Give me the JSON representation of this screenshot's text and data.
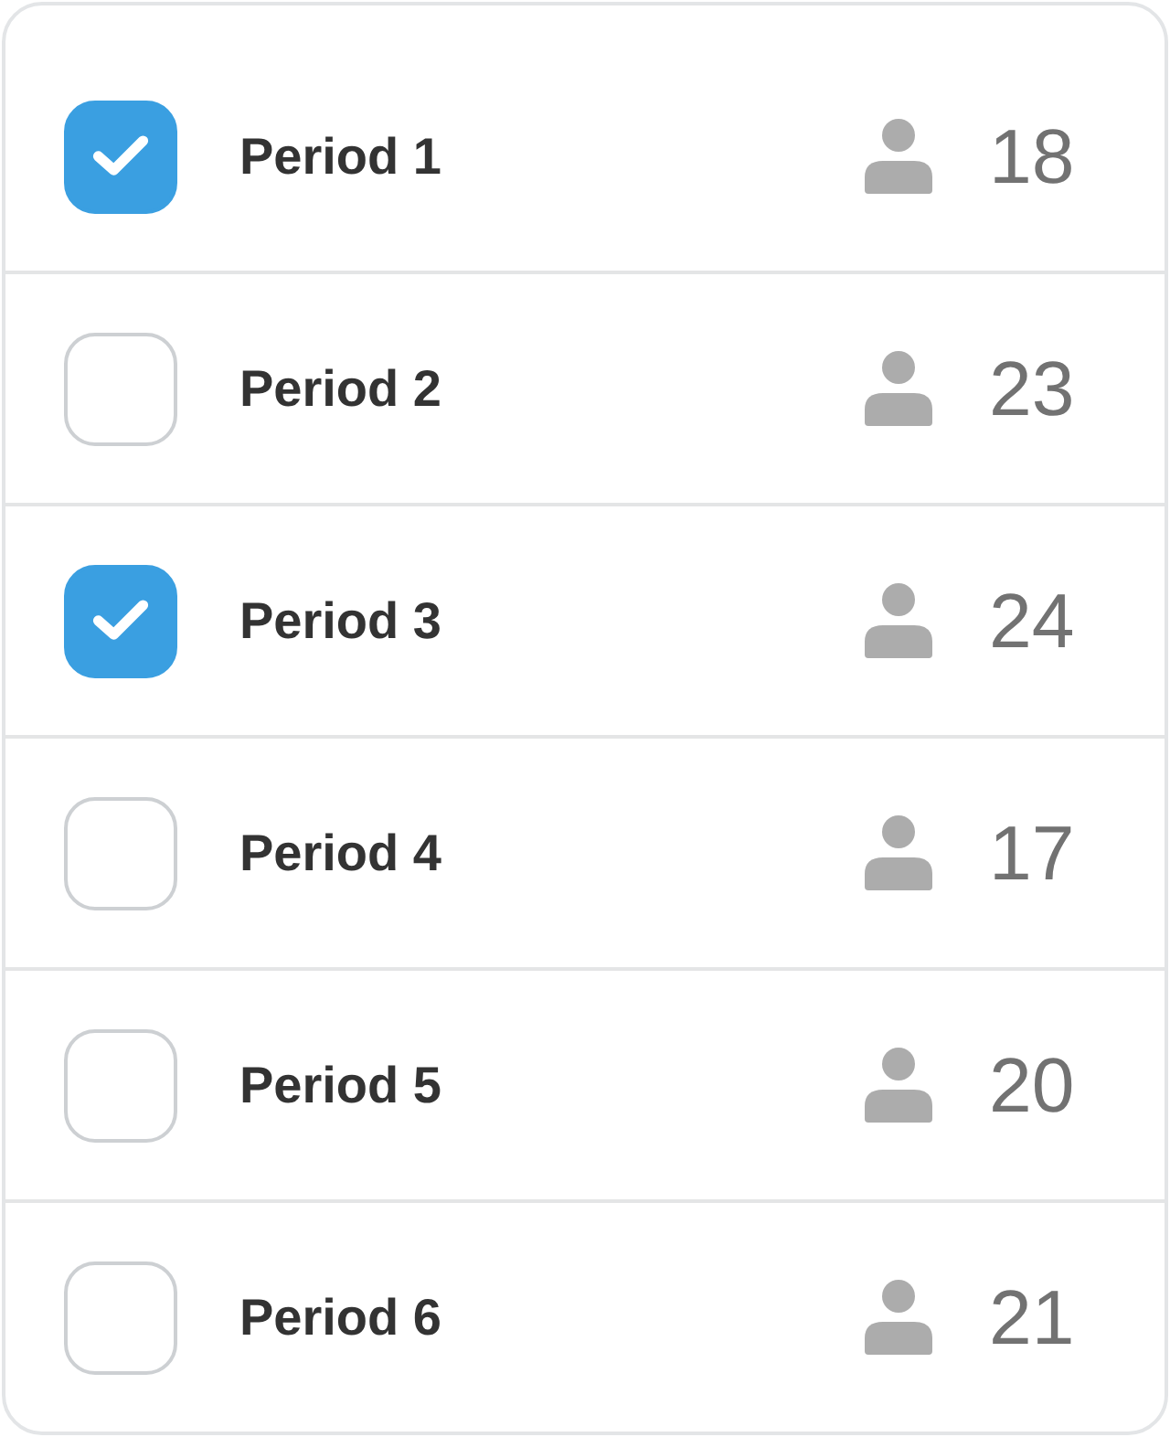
{
  "periods": [
    {
      "label": "Period 1",
      "checked": true,
      "count": "18"
    },
    {
      "label": "Period 2",
      "checked": false,
      "count": "23"
    },
    {
      "label": "Period 3",
      "checked": true,
      "count": "24"
    },
    {
      "label": "Period 4",
      "checked": false,
      "count": "17"
    },
    {
      "label": "Period 5",
      "checked": false,
      "count": "20"
    },
    {
      "label": "Period 6",
      "checked": false,
      "count": "21"
    }
  ]
}
